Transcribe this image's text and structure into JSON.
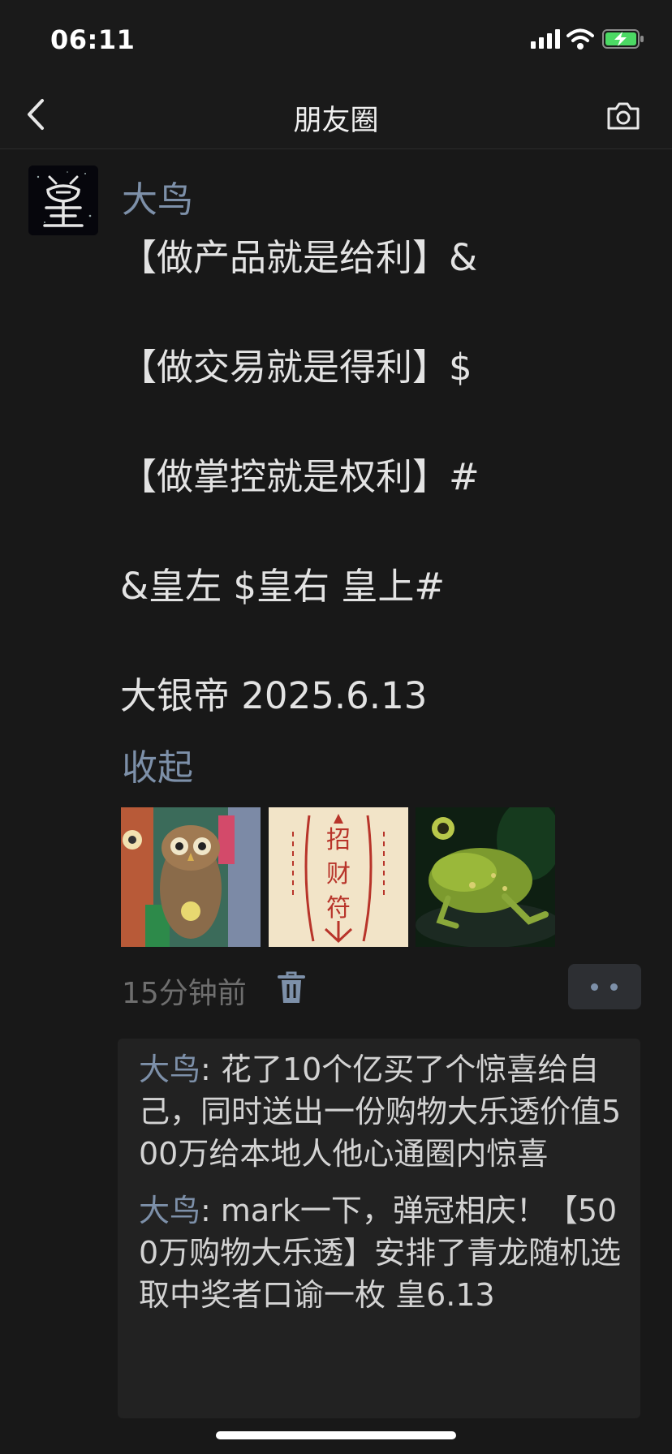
{
  "status_bar": {
    "time": "06:11"
  },
  "nav": {
    "title": "朋友圈"
  },
  "post": {
    "author": "大鸟",
    "lines": [
      "【做产品就是给利】&",
      "【做交易就是得利】$",
      "【做掌控就是权利】#",
      "&皇左 $皇右 皇上#",
      "大银帝 2025.6.13"
    ],
    "collapse_label": "收起",
    "time_ago": "15分钟前"
  },
  "comments": [
    {
      "author": "大鸟",
      "separator": ": ",
      "text": "花了10个亿买了个惊喜给自己，同时送出一份购物大乐透价值500万给本地人他心通圈内惊喜"
    },
    {
      "author": "大鸟",
      "separator": ": ",
      "text": "mark一下，弹冠相庆！【500万购物大乐透】安排了青龙随机选取中奖者口谕一枚 皇6.13"
    }
  ],
  "colors": {
    "link": "#7d90a9",
    "background": "#181818",
    "comment_bg": "#222222",
    "battery": "#4cd964"
  },
  "icons": [
    "signal-icon",
    "wifi-icon",
    "battery-charging-icon",
    "back-icon",
    "camera-icon",
    "trash-icon",
    "more-icon"
  ]
}
